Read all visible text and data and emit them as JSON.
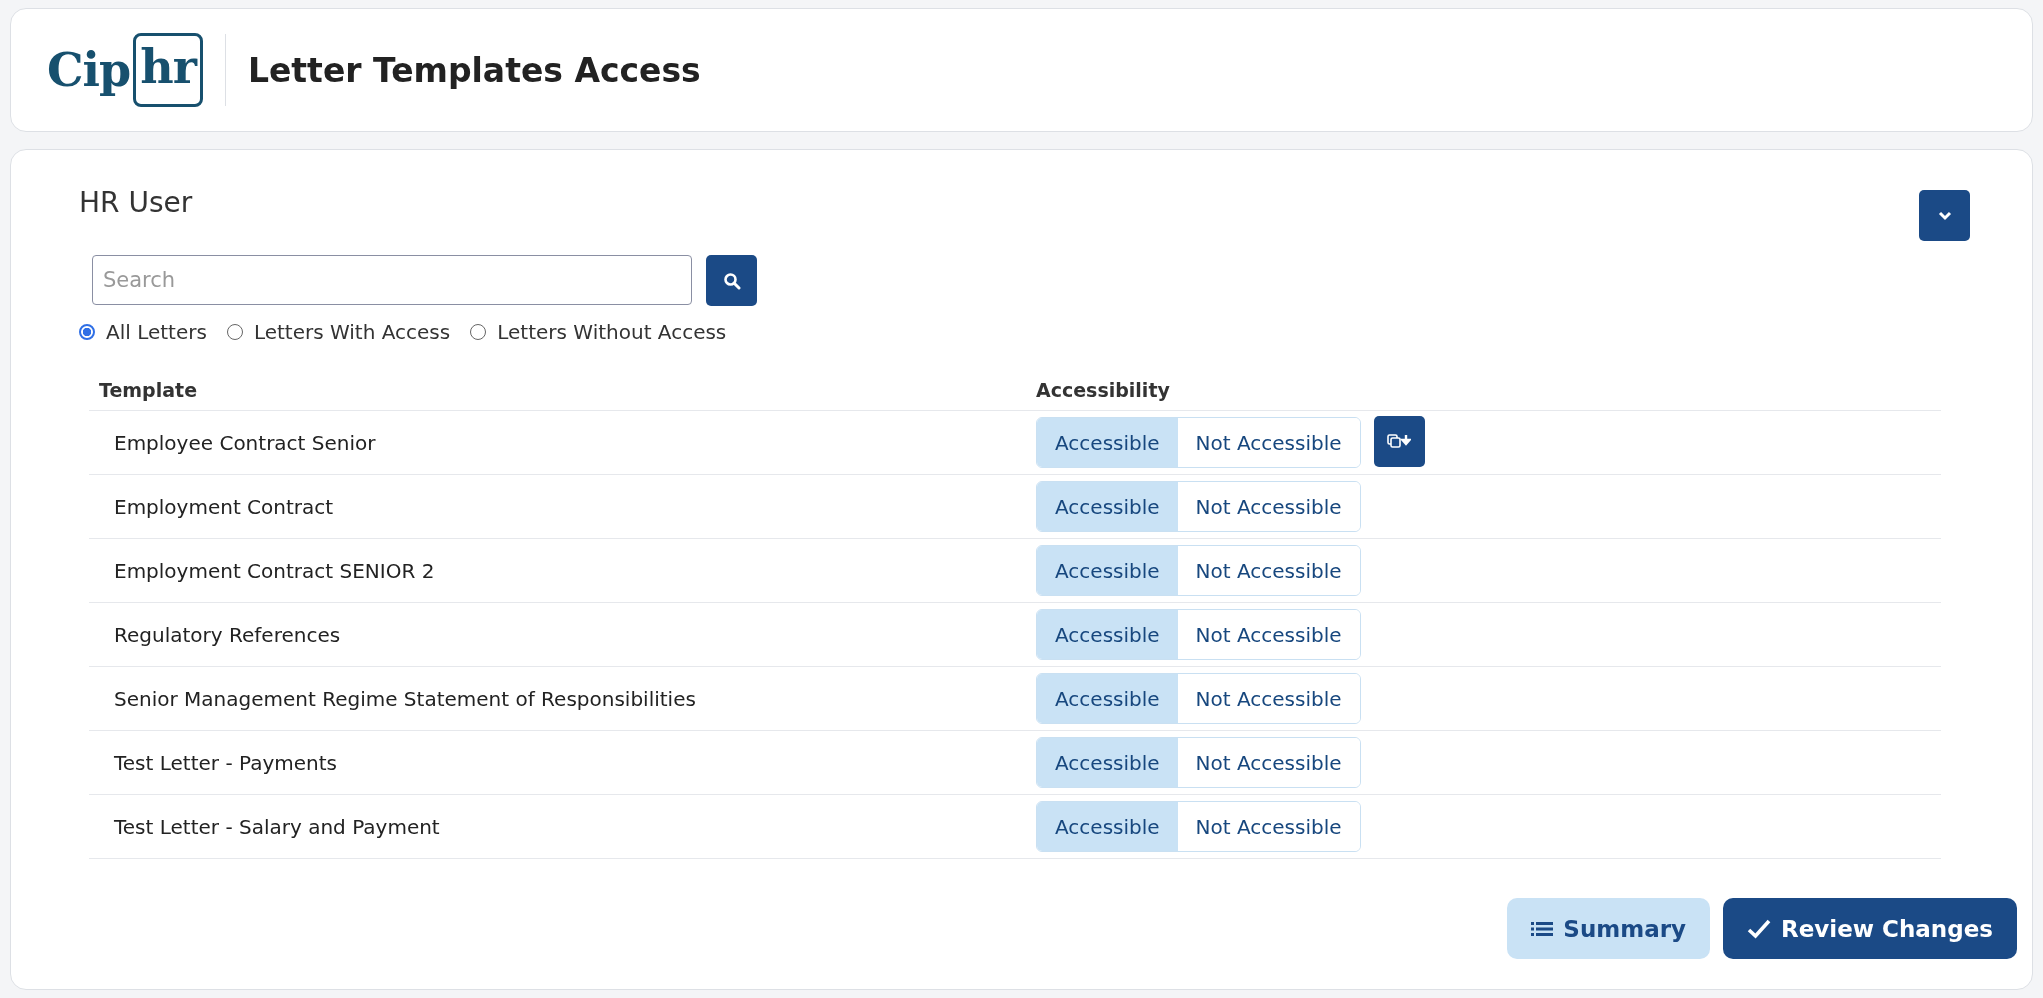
{
  "header": {
    "logo": {
      "plain": "Cip",
      "boxed": "hr"
    },
    "title": "Letter Templates Access"
  },
  "panel": {
    "title": "HR User",
    "expanded": false,
    "search": {
      "placeholder": "Search"
    },
    "filters": [
      {
        "label": "All Letters",
        "selected": true
      },
      {
        "label": "Letters With Access",
        "selected": false
      },
      {
        "label": "Letters Without Access",
        "selected": false
      }
    ],
    "table": {
      "columns": [
        "Template",
        "Accessibility"
      ],
      "rows": [
        {
          "template": "Employee Contract Senior",
          "options": [
            {
              "label": "Accessible",
              "selected": true
            },
            {
              "label": "Not Accessible",
              "selected": false
            }
          ],
          "copy_button": true
        },
        {
          "template": "Employment Contract",
          "options": [
            {
              "label": "Accessible",
              "selected": true
            },
            {
              "label": "Not Accessible",
              "selected": false
            }
          ],
          "copy_button": false
        },
        {
          "template": "Employment Contract SENIOR 2",
          "options": [
            {
              "label": "Accessible",
              "selected": true
            },
            {
              "label": "Not Accessible",
              "selected": false
            }
          ],
          "copy_button": false
        },
        {
          "template": "Regulatory References",
          "options": [
            {
              "label": "Accessible",
              "selected": true
            },
            {
              "label": "Not Accessible",
              "selected": false
            }
          ],
          "copy_button": false
        },
        {
          "template": "Senior Management Regime Statement of Responsibilities",
          "options": [
            {
              "label": "Accessible",
              "selected": true
            },
            {
              "label": "Not Accessible",
              "selected": false
            }
          ],
          "copy_button": false
        },
        {
          "template": "Test Letter - Payments",
          "options": [
            {
              "label": "Accessible",
              "selected": true
            },
            {
              "label": "Not Accessible",
              "selected": false
            }
          ],
          "copy_button": false
        },
        {
          "template": "Test Letter - Salary and Payment",
          "options": [
            {
              "label": "Accessible",
              "selected": true
            },
            {
              "label": "Not Accessible",
              "selected": false
            }
          ],
          "copy_button": false
        }
      ]
    }
  },
  "footer": {
    "buttons": [
      {
        "label": "Summary",
        "kind": "secondary"
      },
      {
        "label": "Review Changes",
        "kind": "primary"
      }
    ]
  }
}
